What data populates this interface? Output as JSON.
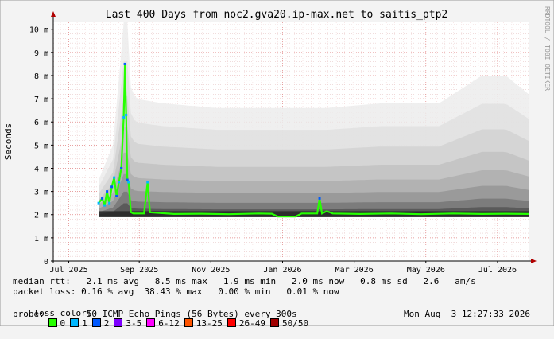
{
  "chart_data": {
    "type": "area",
    "title": "Last 400 Days from noc2.gva20.ip-max.net to saitis_ptp2",
    "ylabel": "Seconds",
    "xlabel": "",
    "watermark": "RRDTOOL / TOBI OETIKER",
    "ylim": [
      0,
      0.0103
    ],
    "x_range": [
      "2025-07-01",
      "2026-08-03"
    ],
    "yticks": [
      {
        "value": 0,
        "label": "0"
      },
      {
        "value": 0.001,
        "label": "1 m"
      },
      {
        "value": 0.002,
        "label": "2 m"
      },
      {
        "value": 0.003,
        "label": "3 m"
      },
      {
        "value": 0.004,
        "label": "4 m"
      },
      {
        "value": 0.005,
        "label": "5 m"
      },
      {
        "value": 0.006,
        "label": "6 m"
      },
      {
        "value": 0.007,
        "label": "7 m"
      },
      {
        "value": 0.008,
        "label": "8 m"
      },
      {
        "value": 0.009,
        "label": "9 m"
      },
      {
        "value": 0.01,
        "label": "10 m"
      }
    ],
    "xticks": [
      {
        "date": "2025-07-14",
        "label": "Jul 2025"
      },
      {
        "date": "2025-09-11",
        "label": "Sep 2025"
      },
      {
        "date": "2025-11-10",
        "label": "Nov 2025"
      },
      {
        "date": "2026-01-09",
        "label": "Jan 2026"
      },
      {
        "date": "2026-03-10",
        "label": "Mar 2026"
      },
      {
        "date": "2026-05-09",
        "label": "May 2026"
      },
      {
        "date": "2026-07-08",
        "label": "Jul 2026"
      }
    ],
    "series": [
      {
        "name": "median rtt",
        "points": [
          [
            "2025-08-08",
            0.0025
          ],
          [
            "2025-08-11",
            0.0027
          ],
          [
            "2025-08-13",
            0.0024
          ],
          [
            "2025-08-15",
            0.003
          ],
          [
            "2025-08-17",
            0.0025
          ],
          [
            "2025-08-19",
            0.0032
          ],
          [
            "2025-08-21",
            0.0036
          ],
          [
            "2025-08-23",
            0.0028
          ],
          [
            "2025-08-25",
            0.0034
          ],
          [
            "2025-08-27",
            0.004
          ],
          [
            "2025-08-29",
            0.0062
          ],
          [
            "2025-08-30",
            0.0085
          ],
          [
            "2025-08-31",
            0.0063
          ],
          [
            "2025-09-01",
            0.0035
          ],
          [
            "2025-09-02",
            0.0034
          ],
          [
            "2025-09-04",
            0.0021
          ],
          [
            "2025-09-06",
            0.00205
          ],
          [
            "2025-09-15",
            0.00205
          ],
          [
            "2025-09-18",
            0.0034
          ],
          [
            "2025-09-20",
            0.0021
          ],
          [
            "2025-10-10",
            0.00203
          ],
          [
            "2025-11-01",
            0.00204
          ],
          [
            "2025-11-25",
            0.00202
          ],
          [
            "2025-12-20",
            0.00205
          ],
          [
            "2025-12-31",
            0.00204
          ],
          [
            "2026-01-05",
            0.00192
          ],
          [
            "2026-01-20",
            0.00192
          ],
          [
            "2026-01-25",
            0.00205
          ],
          [
            "2026-02-07",
            0.00205
          ],
          [
            "2026-02-09",
            0.0027
          ],
          [
            "2026-02-11",
            0.00205
          ],
          [
            "2026-02-15",
            0.00215
          ],
          [
            "2026-02-20",
            0.00205
          ],
          [
            "2026-03-15",
            0.00203
          ],
          [
            "2026-04-10",
            0.00205
          ],
          [
            "2026-05-05",
            0.00202
          ],
          [
            "2026-06-01",
            0.00205
          ],
          [
            "2026-06-25",
            0.00203
          ],
          [
            "2026-07-15",
            0.00204
          ],
          [
            "2026-08-03",
            0.00203
          ]
        ]
      }
    ],
    "smoke": {
      "start": "2025-08-08",
      "end": "2026-08-03",
      "min_rtt": 0.0019,
      "upper_envelope": [
        [
          "2025-08-08",
          0.0035
        ],
        [
          "2025-08-20",
          0.005
        ],
        [
          "2025-08-27",
          0.009
        ],
        [
          "2025-08-29",
          0.0103
        ],
        [
          "2025-09-01",
          0.0103
        ],
        [
          "2025-09-04",
          0.0075
        ],
        [
          "2025-09-08",
          0.007
        ],
        [
          "2025-10-01",
          0.0068
        ],
        [
          "2025-11-15",
          0.0066
        ],
        [
          "2026-01-01",
          0.0066
        ],
        [
          "2026-02-15",
          0.0066
        ],
        [
          "2026-04-01",
          0.0068
        ],
        [
          "2026-05-20",
          0.0068
        ],
        [
          "2026-06-10",
          0.0075
        ],
        [
          "2026-06-25",
          0.008
        ],
        [
          "2026-07-15",
          0.008
        ],
        [
          "2026-08-03",
          0.0072
        ]
      ]
    },
    "grid": true
  },
  "stats": {
    "median_rtt": "median rtt:   2.1 ms avg   8.5 ms max   1.9 ms min   2.0 ms now   0.8 ms sd   2.6   am/s",
    "packet_loss": "packet loss: 0.16 % avg  38.43 % max   0.00 % min   0.01 % now",
    "loss_color_label": "loss color:",
    "probe": "probe:        50 ICMP Echo Pings (56 Bytes) every 300s",
    "timestamp": "Mon Aug  3 12:27:33 2026"
  },
  "loss_colors": [
    {
      "label": "0",
      "color": "#26ff00"
    },
    {
      "label": "1",
      "color": "#00b8ff"
    },
    {
      "label": "2",
      "color": "#0059ff"
    },
    {
      "label": "3-5",
      "color": "#7e00ff"
    },
    {
      "label": "6-12",
      "color": "#ff00ff"
    },
    {
      "label": "13-25",
      "color": "#ff5500"
    },
    {
      "label": "26-49",
      "color": "#ff0000"
    },
    {
      "label": "50/50",
      "color": "#a10000"
    }
  ]
}
